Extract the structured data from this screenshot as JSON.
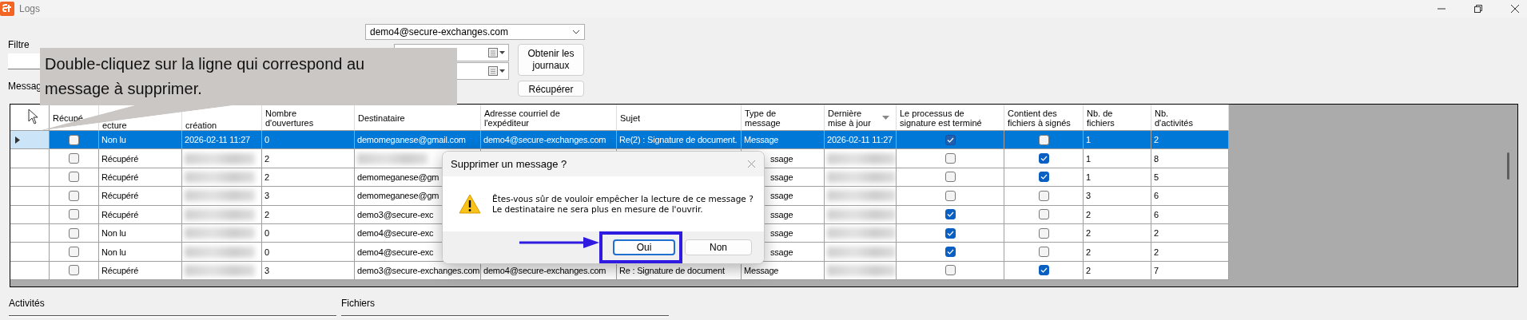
{
  "window": {
    "title": "Logs"
  },
  "filter": {
    "label": "Filtre"
  },
  "account": {
    "value": "demo4@secure-exchanges.com"
  },
  "buttons": [
    {
      "label": "Obtenir les journaux"
    },
    {
      "label": "Récupérer"
    }
  ],
  "messages_label": "Messag",
  "callout": "Double-cliquez sur la ligne qui correspond au message à supprimer.",
  "table": {
    "columns": [
      {
        "label": "Récupé",
        "kind": "full",
        "sorted": false
      },
      {
        "label": "ecture",
        "kind": "partial",
        "sorted": false
      },
      {
        "label": "création",
        "kind": "partial",
        "sorted": false
      },
      {
        "label": "Nombre\nd'ouvertures",
        "kind": "full",
        "sorted": false
      },
      {
        "label": "Destinataire",
        "kind": "full",
        "sorted": false
      },
      {
        "label": "Adresse courriel de\nl'expéditeur",
        "kind": "full",
        "sorted": false
      },
      {
        "label": "Sujet",
        "kind": "full",
        "sorted": false
      },
      {
        "label": "Type de\nmessage",
        "kind": "full",
        "sorted": false
      },
      {
        "label": "Dernière\nmise à jour",
        "kind": "full",
        "sorted": true
      },
      {
        "label": "Le processus de\nsignature est terminé",
        "kind": "full",
        "sorted": false
      },
      {
        "label": "Contient des\nfichiers à signés",
        "kind": "full",
        "sorted": false
      },
      {
        "label": "Nb. de\nfichiers",
        "kind": "full",
        "sorted": false
      },
      {
        "label": "Nb.\nd'activités",
        "kind": "full",
        "sorted": false
      }
    ],
    "rows": [
      {
        "selected": true,
        "cells": [
          {
            "kind": "check",
            "checked": false
          },
          "Non lu",
          "2026-02-11 11:27",
          "0",
          "demomeganese@gmail.com",
          "demo4@secure-exchanges.com",
          "Re(2) : Signature de document.",
          "Message",
          "2026-02-11 11:27",
          {
            "kind": "check",
            "checked": true
          },
          {
            "kind": "check",
            "checked": false
          },
          "1",
          "2"
        ]
      },
      {
        "selected": false,
        "cells": [
          {
            "kind": "check",
            "checked": false
          },
          "Récupéré",
          {
            "kind": "redacted"
          },
          "2",
          {
            "kind": "redacted"
          },
          null,
          null,
          {
            "kind": "clipped",
            "text": "ssage"
          },
          {
            "kind": "redacted"
          },
          {
            "kind": "check",
            "checked": false
          },
          {
            "kind": "check",
            "checked": true
          },
          "1",
          "8"
        ]
      },
      {
        "selected": false,
        "cells": [
          {
            "kind": "check",
            "checked": false
          },
          "Récupéré",
          {
            "kind": "redacted"
          },
          "2",
          "demomeganese@gm",
          null,
          null,
          {
            "kind": "clipped",
            "text": "ssage"
          },
          {
            "kind": "redacted"
          },
          {
            "kind": "check",
            "checked": false
          },
          {
            "kind": "check",
            "checked": true
          },
          "1",
          "5"
        ]
      },
      {
        "selected": false,
        "cells": [
          {
            "kind": "check",
            "checked": false
          },
          "Récupéré",
          {
            "kind": "redacted"
          },
          "3",
          "demomeganese@gm",
          null,
          null,
          {
            "kind": "clipped",
            "text": "ssage"
          },
          {
            "kind": "redacted"
          },
          {
            "kind": "check",
            "checked": false
          },
          {
            "kind": "check",
            "checked": false
          },
          "3",
          "6"
        ]
      },
      {
        "selected": false,
        "cells": [
          {
            "kind": "check",
            "checked": false
          },
          "Récupéré",
          {
            "kind": "redacted"
          },
          "2",
          "demo3@secure-exc",
          null,
          null,
          {
            "kind": "clipped",
            "text": "ssage"
          },
          {
            "kind": "redacted"
          },
          {
            "kind": "check",
            "checked": true
          },
          {
            "kind": "check",
            "checked": false
          },
          "2",
          "6"
        ]
      },
      {
        "selected": false,
        "cells": [
          {
            "kind": "check",
            "checked": false
          },
          "Non lu",
          {
            "kind": "redacted"
          },
          "0",
          "demo4@secure-exc",
          null,
          null,
          {
            "kind": "clipped",
            "text": "ssage"
          },
          {
            "kind": "redacted"
          },
          {
            "kind": "check",
            "checked": true
          },
          {
            "kind": "check",
            "checked": false
          },
          "2",
          "2"
        ]
      },
      {
        "selected": false,
        "cells": [
          {
            "kind": "check",
            "checked": false
          },
          "Non lu",
          {
            "kind": "redacted"
          },
          "0",
          "demo4@secure-exc",
          null,
          null,
          {
            "kind": "clipped",
            "text": "ssage"
          },
          {
            "kind": "redacted"
          },
          {
            "kind": "check",
            "checked": true
          },
          {
            "kind": "check",
            "checked": false
          },
          "2",
          "2"
        ]
      },
      {
        "selected": false,
        "cells": [
          {
            "kind": "check",
            "checked": false
          },
          "Récupéré",
          {
            "kind": "redacted"
          },
          "3",
          "demo3@secure-exchanges.com",
          "demo4@secure-exchanges.com",
          "Re : Signature de document",
          "Message",
          {
            "kind": "redacted"
          },
          {
            "kind": "check",
            "checked": false
          },
          {
            "kind": "check",
            "checked": true
          },
          "2",
          "7"
        ]
      }
    ]
  },
  "dialog": {
    "title": "Supprimer un message ?",
    "message": "Êtes-vous sûr de vouloir empêcher la lecture de ce message ?\nLe destinataire ne sera plus en mesure de l'ouvrir.",
    "buttons": [
      {
        "label": "Oui",
        "highlighted": true
      },
      {
        "label": "Non",
        "highlighted": false
      }
    ]
  },
  "panels": [
    {
      "label": "Activités"
    },
    {
      "label": "Fichiers"
    }
  ]
}
